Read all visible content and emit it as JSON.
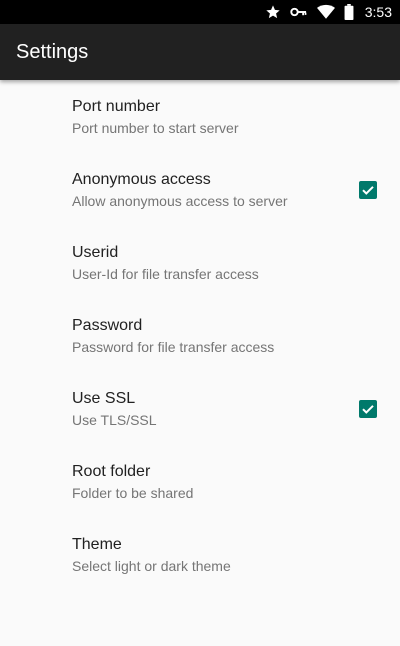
{
  "status_bar": {
    "time": "3:53",
    "icons": [
      "star-icon",
      "key-icon",
      "wifi-icon",
      "battery-icon"
    ]
  },
  "app_bar": {
    "title": "Settings"
  },
  "preferences": [
    {
      "title": "Port number",
      "summary": "Port number to start server",
      "checkbox": false
    },
    {
      "title": "Anonymous access",
      "summary": "Allow anonymous access to server",
      "checkbox": true,
      "checked": true
    },
    {
      "title": "Userid",
      "summary": "User-Id for file transfer access",
      "checkbox": false
    },
    {
      "title": "Password",
      "summary": "Password for file transfer access",
      "checkbox": false
    },
    {
      "title": "Use SSL",
      "summary": "Use TLS/SSL",
      "checkbox": true,
      "checked": true
    },
    {
      "title": "Root folder",
      "summary": "Folder to be shared",
      "checkbox": false
    },
    {
      "title": "Theme",
      "summary": "Select light or dark theme",
      "checkbox": false
    }
  ],
  "colors": {
    "accent": "#00796b",
    "app_bar": "#212121",
    "background": "#fafafa"
  }
}
